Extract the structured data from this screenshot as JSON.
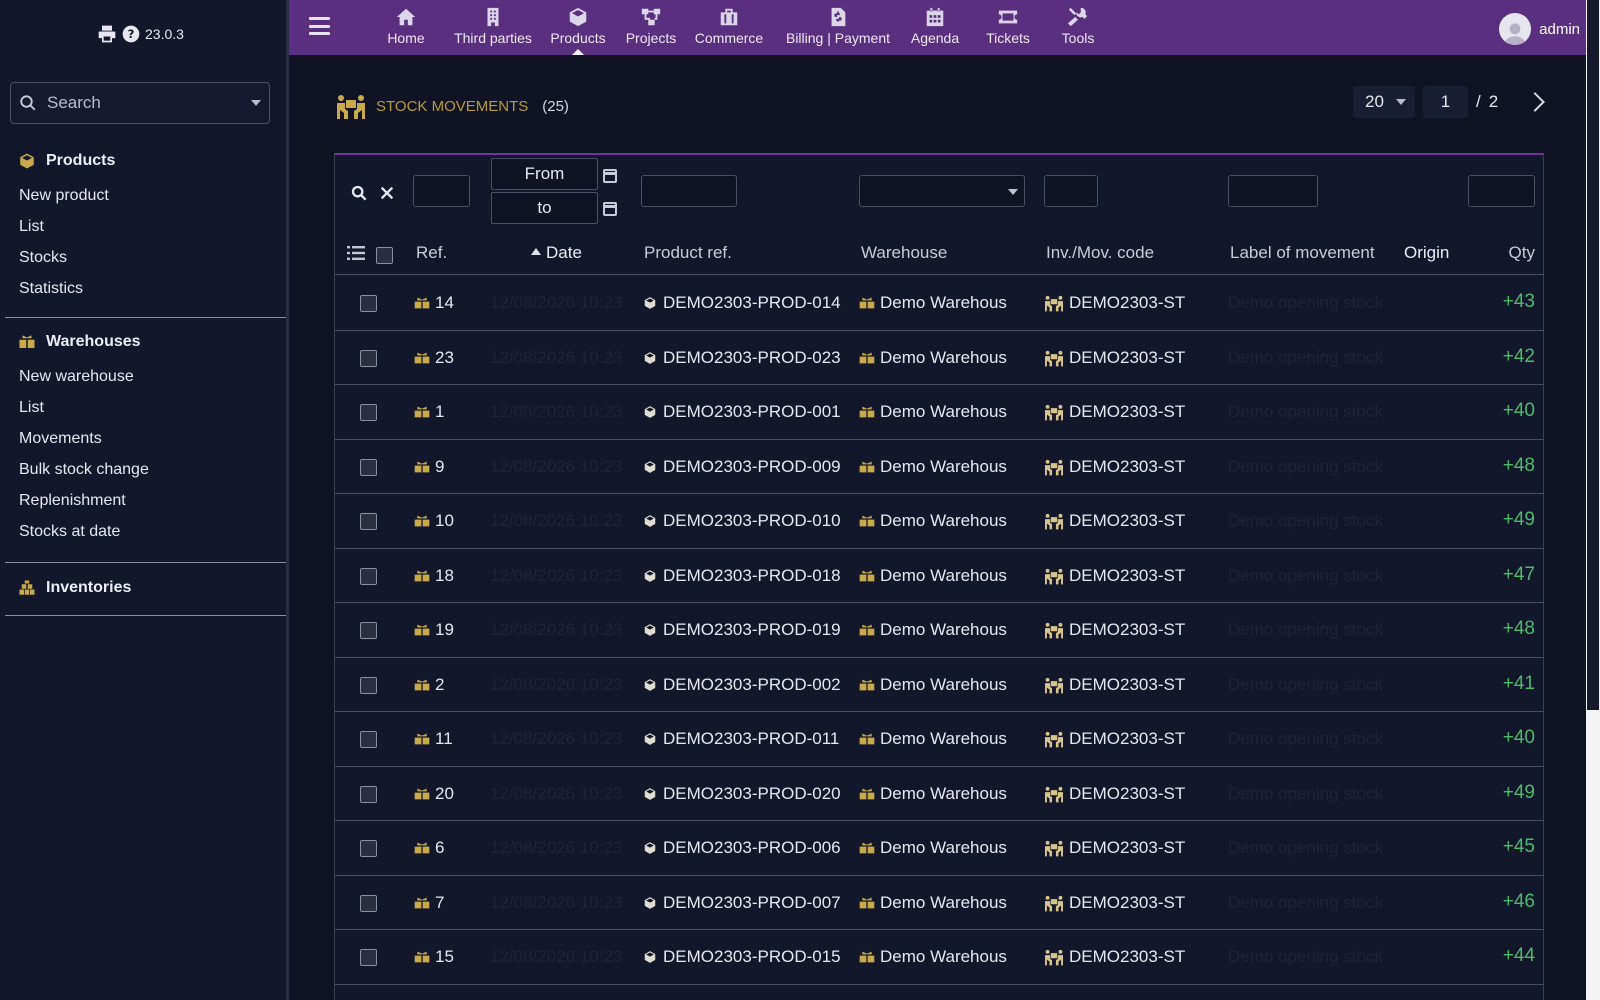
{
  "app": {
    "version": "23.0.3",
    "user": "admin",
    "colors": {
      "topbar": "#5a2f7f",
      "accent": "#c9a94b",
      "qty": "#4dbb6a"
    }
  },
  "sidebar": {
    "search_placeholder": "Search",
    "sections": [
      {
        "title": "Products",
        "icon": "cube-icon",
        "items": [
          "New product",
          "List",
          "Stocks",
          "Statistics"
        ]
      },
      {
        "title": "Warehouses",
        "icon": "boxes-icon",
        "items": [
          "New warehouse",
          "List",
          "Movements",
          "Bulk stock change",
          "Replenishment",
          "Stocks at date"
        ]
      },
      {
        "title": "Inventories",
        "icon": "inventory-icon",
        "items": []
      }
    ]
  },
  "topnav": {
    "items": [
      {
        "label": "Home",
        "icon": "home-icon"
      },
      {
        "label": "Third parties",
        "icon": "building-icon"
      },
      {
        "label": "Products",
        "icon": "cube-icon"
      },
      {
        "label": "Projects",
        "icon": "project-icon"
      },
      {
        "label": "Commerce",
        "icon": "briefcase-icon"
      },
      {
        "label": "Billing | Payment",
        "icon": "invoice-icon"
      },
      {
        "label": "Agenda",
        "icon": "calendar-icon"
      },
      {
        "label": "Tickets",
        "icon": "ticket-icon"
      },
      {
        "label": "Tools",
        "icon": "tools-icon"
      }
    ],
    "active": "Products"
  },
  "page": {
    "title": "STOCK MOVEMENTS",
    "count": "(25)",
    "pager": {
      "limit": "20",
      "page": "1",
      "sep": "/",
      "total": "2"
    }
  },
  "filters": {
    "from": "From",
    "to": "to"
  },
  "table": {
    "columns": [
      "Ref.",
      "Date",
      "Product ref.",
      "Warehouse",
      "Inv./Mov. code",
      "Label of movement",
      "Origin",
      "Qty"
    ],
    "sort_column": "Date",
    "rows": [
      {
        "ref": "14",
        "date": "12/08/2026 10:23",
        "product": "DEMO2303-PROD-014",
        "warehouse": "Demo Warehous",
        "code": "DEMO2303-ST",
        "label": "Demo opening stock",
        "origin": "",
        "qty": "+43"
      },
      {
        "ref": "23",
        "date": "12/08/2026 10:23",
        "product": "DEMO2303-PROD-023",
        "warehouse": "Demo Warehous",
        "code": "DEMO2303-ST",
        "label": "Demo opening stock",
        "origin": "",
        "qty": "+42"
      },
      {
        "ref": "1",
        "date": "12/08/2026 10:23",
        "product": "DEMO2303-PROD-001",
        "warehouse": "Demo Warehous",
        "code": "DEMO2303-ST",
        "label": "Demo opening stock",
        "origin": "",
        "qty": "+40"
      },
      {
        "ref": "9",
        "date": "12/08/2026 10:23",
        "product": "DEMO2303-PROD-009",
        "warehouse": "Demo Warehous",
        "code": "DEMO2303-ST",
        "label": "Demo opening stock",
        "origin": "",
        "qty": "+48"
      },
      {
        "ref": "10",
        "date": "12/08/2026 10:23",
        "product": "DEMO2303-PROD-010",
        "warehouse": "Demo Warehous",
        "code": "DEMO2303-ST",
        "label": "Demo opening stock",
        "origin": "",
        "qty": "+49"
      },
      {
        "ref": "18",
        "date": "12/08/2026 10:23",
        "product": "DEMO2303-PROD-018",
        "warehouse": "Demo Warehous",
        "code": "DEMO2303-ST",
        "label": "Demo opening stock",
        "origin": "",
        "qty": "+47"
      },
      {
        "ref": "19",
        "date": "12/08/2026 10:23",
        "product": "DEMO2303-PROD-019",
        "warehouse": "Demo Warehous",
        "code": "DEMO2303-ST",
        "label": "Demo opening stock",
        "origin": "",
        "qty": "+48"
      },
      {
        "ref": "2",
        "date": "12/08/2026 10:23",
        "product": "DEMO2303-PROD-002",
        "warehouse": "Demo Warehous",
        "code": "DEMO2303-ST",
        "label": "Demo opening stock",
        "origin": "",
        "qty": "+41"
      },
      {
        "ref": "11",
        "date": "12/08/2026 10:23",
        "product": "DEMO2303-PROD-011",
        "warehouse": "Demo Warehous",
        "code": "DEMO2303-ST",
        "label": "Demo opening stock",
        "origin": "",
        "qty": "+40"
      },
      {
        "ref": "20",
        "date": "12/08/2026 10:23",
        "product": "DEMO2303-PROD-020",
        "warehouse": "Demo Warehous",
        "code": "DEMO2303-ST",
        "label": "Demo opening stock",
        "origin": "",
        "qty": "+49"
      },
      {
        "ref": "6",
        "date": "12/08/2026 10:23",
        "product": "DEMO2303-PROD-006",
        "warehouse": "Demo Warehous",
        "code": "DEMO2303-ST",
        "label": "Demo opening stock",
        "origin": "",
        "qty": "+45"
      },
      {
        "ref": "7",
        "date": "12/08/2026 10:23",
        "product": "DEMO2303-PROD-007",
        "warehouse": "Demo Warehous",
        "code": "DEMO2303-ST",
        "label": "Demo opening stock",
        "origin": "",
        "qty": "+46"
      },
      {
        "ref": "15",
        "date": "12/08/2026 10:23",
        "product": "DEMO2303-PROD-015",
        "warehouse": "Demo Warehous",
        "code": "DEMO2303-ST",
        "label": "Demo opening stock",
        "origin": "",
        "qty": "+44"
      }
    ]
  }
}
